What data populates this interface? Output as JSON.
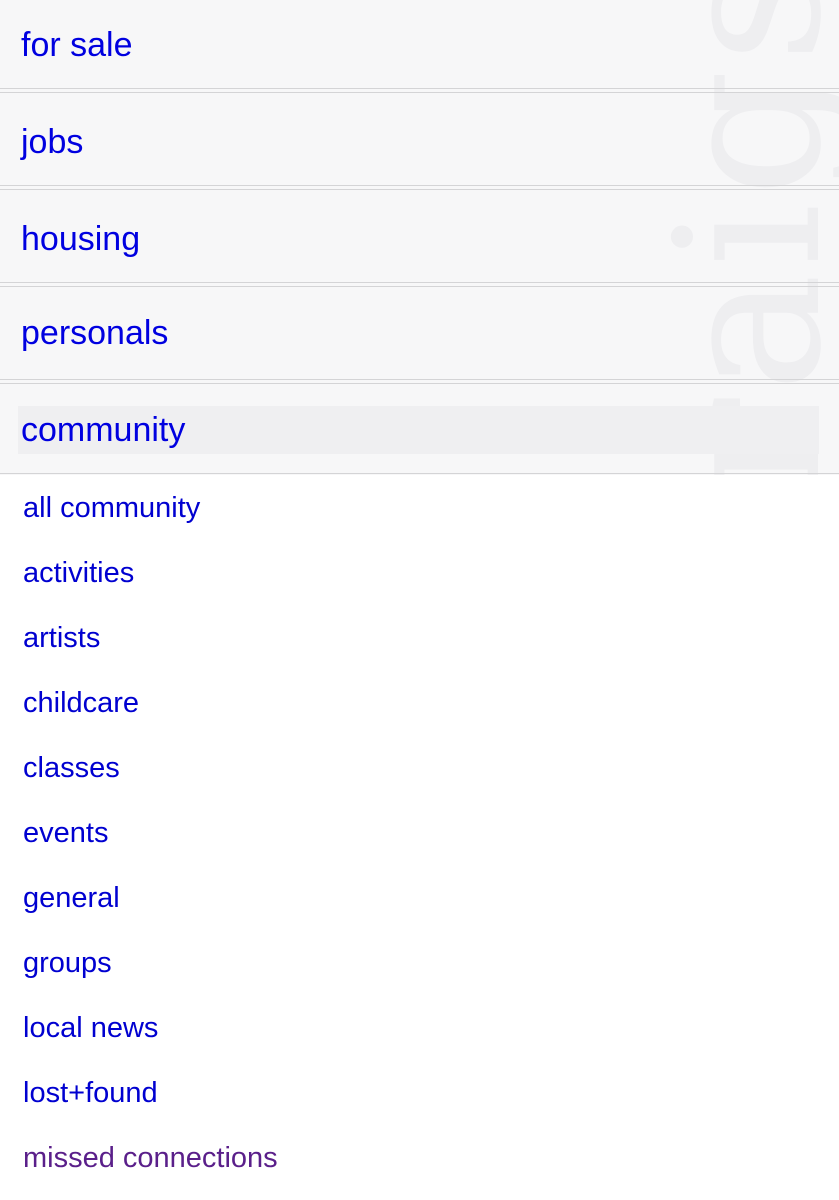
{
  "watermark": {
    "text": "craigslist"
  },
  "sections": [
    {
      "label": "for sale"
    },
    {
      "label": "jobs"
    },
    {
      "label": "housing"
    },
    {
      "label": "personals"
    },
    {
      "label": "community",
      "expanded": true
    }
  ],
  "community_items": [
    {
      "label": "all community"
    },
    {
      "label": "activities"
    },
    {
      "label": "artists"
    },
    {
      "label": "childcare"
    },
    {
      "label": "classes"
    },
    {
      "label": "events"
    },
    {
      "label": "general"
    },
    {
      "label": "groups"
    },
    {
      "label": "local news"
    },
    {
      "label": "lost+found"
    },
    {
      "label": "missed connections",
      "visited": true
    }
  ],
  "colors": {
    "link": "#0000e0",
    "visited_link": "#5a1f8a",
    "section_background": "#f7f7f8",
    "divider": "#d4d4d6"
  }
}
